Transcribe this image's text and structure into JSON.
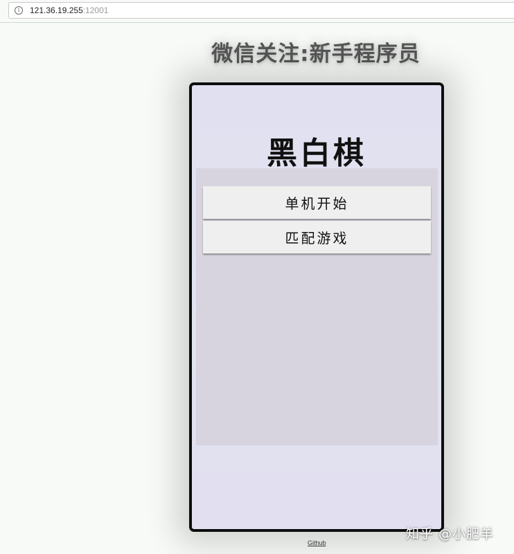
{
  "browser": {
    "url_host": "121.36.19.255",
    "url_port": ":12001",
    "info_icon_symbol": "i"
  },
  "page": {
    "heading": "微信关注:新手程序员"
  },
  "game": {
    "title": "黑白棋",
    "buttons": {
      "single": "单机开始",
      "match": "匹配游戏"
    }
  },
  "footer": {
    "github_label": "Github"
  },
  "watermark": {
    "text": "知乎 @小肥羊"
  },
  "colors": {
    "page_background": "#f7faf7",
    "device_frame": "#0d0d0d",
    "device_screen": "#e1e0f1",
    "menu_panel": "#d7d4df",
    "button_background": "#efefef",
    "heading_text": "#555555"
  }
}
